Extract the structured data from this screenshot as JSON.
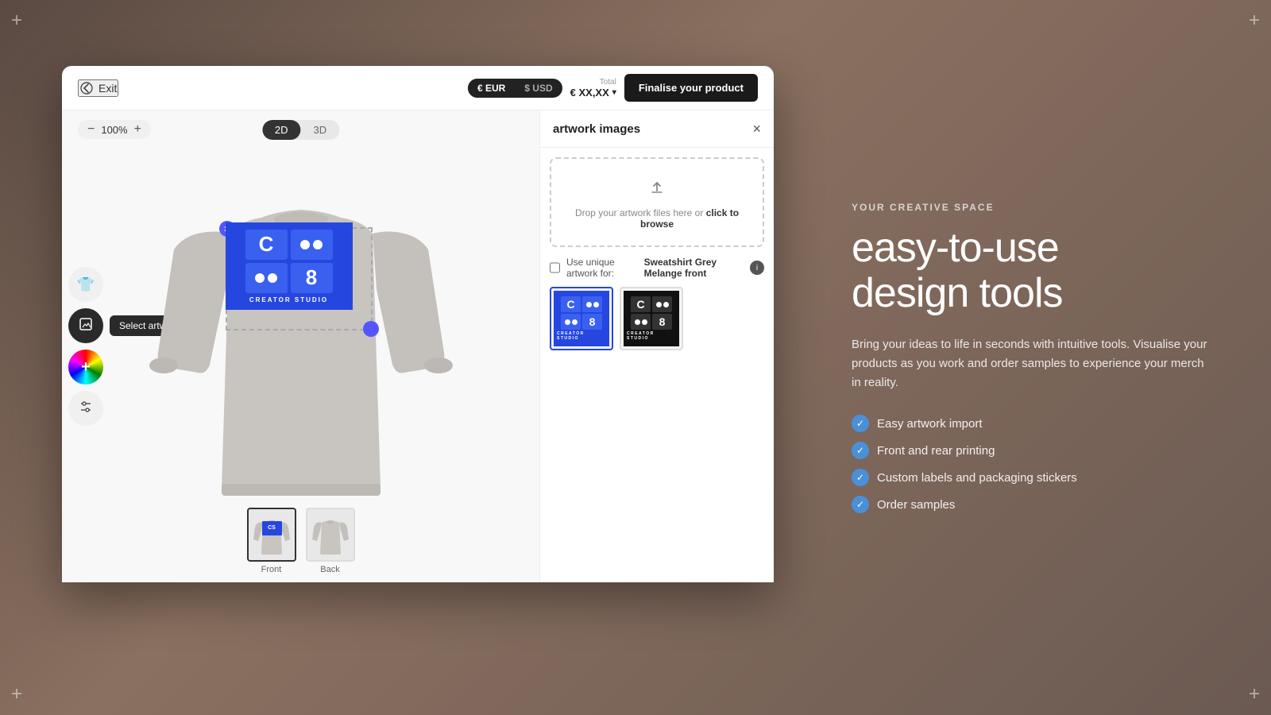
{
  "background": {
    "color": "#6b5a52"
  },
  "corners": {
    "tl": "+",
    "tr": "+",
    "bl": "+",
    "br": "+"
  },
  "header": {
    "exit_label": "Exit",
    "currency_eur": "€ EUR",
    "currency_usd": "$ USD",
    "total_label": "Total",
    "total_value": "€ XX,XX",
    "finalise_label": "Finalise your product"
  },
  "canvas": {
    "zoom_minus": "−",
    "zoom_value": "100%",
    "zoom_plus": "+",
    "view_2d": "2D",
    "view_3d": "3D",
    "active_view": "2D"
  },
  "toolbar": {
    "shirt_icon": "👕",
    "artwork_icon": "🎨",
    "add_icon": "+",
    "adjust_icon": "⚙"
  },
  "tooltip": {
    "label": "Select artwork"
  },
  "thumbnails": [
    {
      "label": "Front",
      "active": true
    },
    {
      "label": "Back",
      "active": false
    }
  ],
  "artwork_panel": {
    "title": "artwork images",
    "close_icon": "×",
    "dropzone_text": "Drop your artwork files here or",
    "dropzone_link": "click to browse",
    "checkbox_label": "Use unique artwork for:",
    "checkbox_product": "Sweatshirt Grey Melange front",
    "images": [
      {
        "id": 1,
        "type": "blue",
        "selected": true
      },
      {
        "id": 2,
        "type": "black",
        "selected": false
      }
    ]
  },
  "marketing": {
    "eyebrow": "YOUR CREATIVE SPACE",
    "headline": "easy-to-use\ndesign tools",
    "description": "Bring your ideas to life in seconds with intuitive tools. Visualise your products as you work and order samples to experience your merch in reality.",
    "features": [
      "Easy artwork import",
      "Front and rear printing",
      "Custom labels and packaging stickers",
      "Order samples"
    ]
  }
}
